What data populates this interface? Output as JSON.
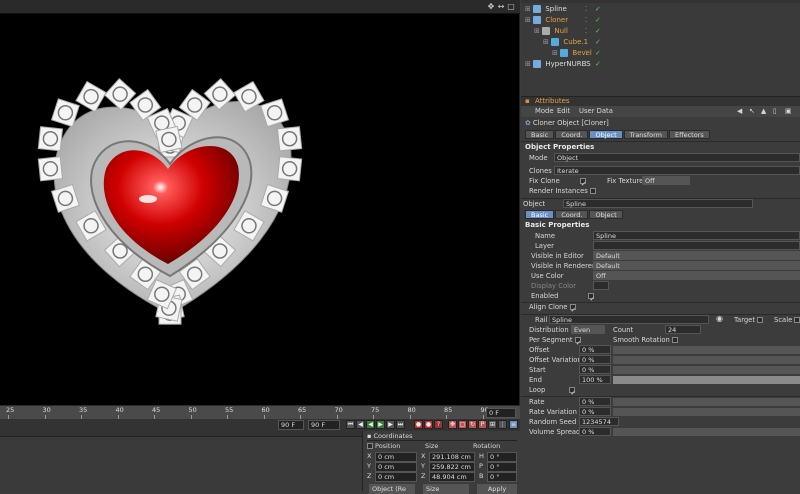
{
  "viewport": {
    "frame_field": "0 F"
  },
  "timeline": {
    "ticks": [
      "25",
      "30",
      "35",
      "40",
      "45",
      "50",
      "55",
      "60",
      "65",
      "70",
      "75",
      "80",
      "85",
      "90"
    ],
    "end_field": "90 F",
    "end_field2": "90 F"
  },
  "coordinates": {
    "title": "Coordinates",
    "col_position": "Position",
    "col_size": "Size",
    "col_rotation": "Rotation",
    "rows": [
      {
        "axis": "X",
        "pos": "0 cm",
        "size_axis": "X",
        "size": "291.108 cm",
        "rot_axis": "H",
        "rot": "0 °"
      },
      {
        "axis": "Y",
        "pos": "0 cm",
        "size_axis": "Y",
        "size": "259.822 cm",
        "rot_axis": "P",
        "rot": "0 °"
      },
      {
        "axis": "Z",
        "pos": "0 cm",
        "size_axis": "Z",
        "size": "48.904 cm",
        "rot_axis": "B",
        "rot": "0 °"
      }
    ],
    "mode_select": "Object (Re",
    "size_select": "Size",
    "apply": "Apply"
  },
  "objects": [
    {
      "name": "Spline",
      "indent": 0
    },
    {
      "name": "Cloner",
      "indent": 0
    },
    {
      "name": "Null",
      "indent": 1
    },
    {
      "name": "Cube.1",
      "indent": 2
    },
    {
      "name": "Bevel",
      "indent": 3
    },
    {
      "name": "HyperNURBS",
      "indent": 0
    }
  ],
  "attributes": {
    "title": "Attributes",
    "menu": [
      "Mode",
      "Edit",
      "User Data"
    ],
    "object_title": "Cloner Object [Cloner]",
    "tabs": [
      "Basic",
      "Coord.",
      "Object",
      "Transform",
      "Effectors"
    ],
    "section_object": "Object Properties",
    "mode_label": "Mode",
    "mode_value": "Object",
    "clones_label": "Clones",
    "clones_value": "Iterate",
    "fix_clone": "Fix Clone",
    "fix_texture": "Fix Texture",
    "fix_texture_value": "Off",
    "render_instances": "Render Instances",
    "link_label": "Object",
    "link_value": "Spline",
    "subtabs": [
      "Basic",
      "Coord.",
      "Object"
    ],
    "section_basic": "Basic Properties",
    "name_label": "Name",
    "name_value": "Spline",
    "layer_label": "Layer",
    "vis_editor": "Visible in Editor",
    "vis_editor_value": "Default",
    "vis_render": "Visible in Renderer",
    "vis_render_value": "Default",
    "use_color": "Use Color",
    "use_color_value": "Off",
    "display_color": "Display Color",
    "enabled": "Enabled",
    "align_clone": "Align Clone",
    "rail_label": "Rail",
    "rail_value": "Spline",
    "target": "Target",
    "scale": "Scale",
    "distribution": "Distribution",
    "distribution_value": "Even",
    "count_label": "Count",
    "count_value": "24",
    "per_segment": "Per Segment",
    "smooth_rotation": "Smooth Rotation",
    "offset": "Offset",
    "offset_value": "0 %",
    "offset_var": "Offset Variation",
    "offset_var_value": "0 %",
    "start": "Start",
    "start_value": "0 %",
    "end": "End",
    "end_value": "100 %",
    "end_fill": 1.0,
    "loop": "Loop",
    "rate": "Rate",
    "rate_value": "0 %",
    "rate_var": "Rate Variation",
    "rate_var_value": "0 %",
    "random_seed": "Random Seed",
    "random_seed_value": "1234574",
    "volume_spread": "Volume Spread",
    "volume_spread_value": "0 %"
  }
}
